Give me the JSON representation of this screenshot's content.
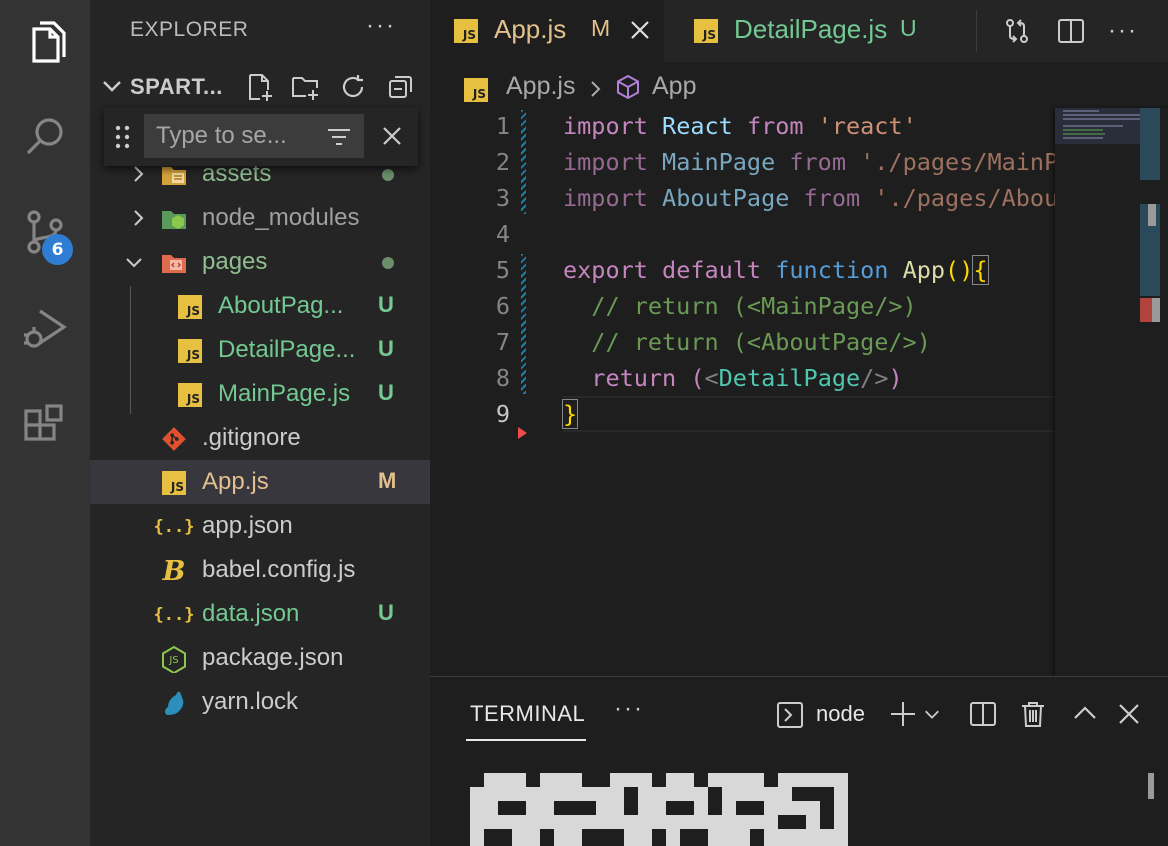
{
  "activity_bar": {
    "scm_badge": "6"
  },
  "sidebar": {
    "title": "EXPLORER",
    "more": "···",
    "section_title": "SPART...",
    "filter_placeholder": "Type to se...",
    "files": [
      {
        "name": "assets",
        "kind": "folder",
        "status": "dot",
        "status_color": "#6b8e6b"
      },
      {
        "name": "node_modules",
        "kind": "folder",
        "status": "",
        "status_color": ""
      },
      {
        "name": "pages",
        "kind": "folder-open",
        "status": "dot",
        "status_color": "#6b8e6b"
      },
      {
        "name": "AboutPag...",
        "kind": "js",
        "status": "U",
        "status_color": "#73c991"
      },
      {
        "name": "DetailPage...",
        "kind": "js",
        "status": "U",
        "status_color": "#73c991"
      },
      {
        "name": "MainPage.js",
        "kind": "js",
        "status": "U",
        "status_color": "#73c991"
      },
      {
        "name": ".gitignore",
        "kind": "git",
        "status": "",
        "status_color": ""
      },
      {
        "name": "App.js",
        "kind": "js",
        "status": "M",
        "status_color": "#e2c08d"
      },
      {
        "name": "app.json",
        "kind": "json",
        "status": "",
        "status_color": ""
      },
      {
        "name": "babel.config.js",
        "kind": "babel",
        "status": "",
        "status_color": ""
      },
      {
        "name": "data.json",
        "kind": "json",
        "status": "U",
        "status_color": "#73c991"
      },
      {
        "name": "package.json",
        "kind": "node",
        "status": "",
        "status_color": ""
      },
      {
        "name": "yarn.lock",
        "kind": "yarn",
        "status": "",
        "status_color": ""
      }
    ]
  },
  "editor": {
    "tabs": [
      {
        "label": "App.js",
        "status": "M",
        "badge": "JS"
      },
      {
        "label": "DetailPage.js",
        "status": "U",
        "badge": "JS"
      }
    ],
    "more": "···",
    "breadcrumb": {
      "file": "App.js",
      "symbol": "App"
    },
    "line_numbers": [
      "1",
      "2",
      "3",
      "4",
      "5",
      "6",
      "7",
      "8",
      "9"
    ],
    "code": {
      "l1": {
        "kw": "import",
        "id": "React",
        "from": "from",
        "str": "'react'"
      },
      "l2": {
        "kw": "import",
        "id": "MainPage",
        "from": "from",
        "str": "'./pages/MainP"
      },
      "l3": {
        "kw": "import",
        "id": "AboutPage",
        "from": "from",
        "str": "'./pages/About"
      },
      "l5": {
        "export": "export",
        "default": "default",
        "function": "function",
        "name": "App",
        "parens": "()",
        "brace": "{"
      },
      "l6": "// return (<MainPage/>)",
      "l7": "// return (<AboutPage/>)",
      "l8": {
        "return": "return",
        "open": "(",
        "lt": "<",
        "tag": "DetailPage",
        "close": "/>",
        "cparen": ")"
      },
      "l9": "}"
    }
  },
  "terminal": {
    "title": "TERMINAL",
    "more": "···",
    "shell": "node"
  },
  "colors": {
    "accent": "#2f7dd2",
    "modified": "#e2c08d",
    "untracked": "#73c991"
  }
}
